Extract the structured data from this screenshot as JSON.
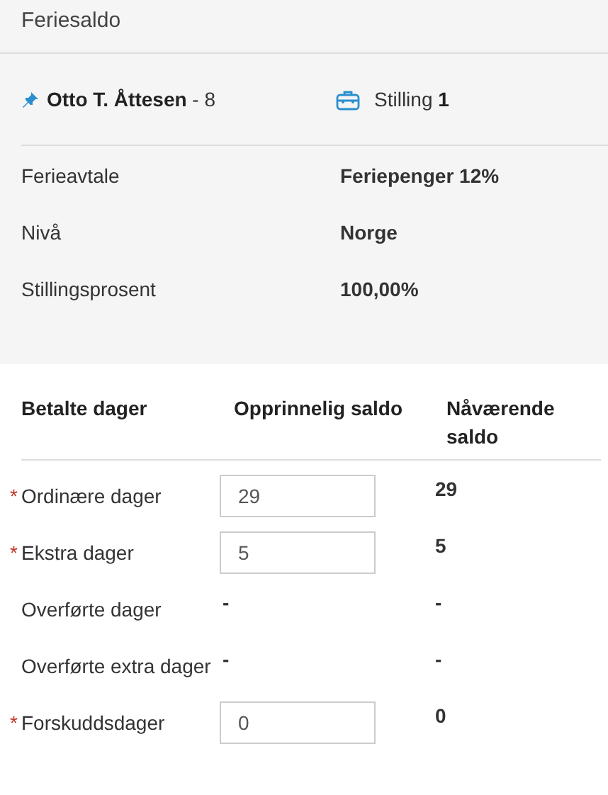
{
  "title": "Feriesaldo",
  "employee": {
    "name": "Otto T. Åttesen",
    "suffix": "- 8",
    "position_label": "Stilling",
    "position_number": "1"
  },
  "details": [
    {
      "label": "Ferieavtale",
      "value": "Feriepenger 12%"
    },
    {
      "label": "Nivå",
      "value": "Norge"
    },
    {
      "label": "Stillingsprosent",
      "value": "100,00%"
    }
  ],
  "table": {
    "columns": [
      "Betalte dager",
      "Opprinnelig saldo",
      "Nåværende saldo"
    ],
    "rows": [
      {
        "marker": "*",
        "label": "Ordinære dager",
        "kind": "input",
        "original": "29",
        "current": "29"
      },
      {
        "marker": "*",
        "label": "Ekstra dager",
        "kind": "input",
        "original": "5",
        "current": "5"
      },
      {
        "label": "Overførte dager",
        "kind": "text",
        "original": "-",
        "current": "-"
      },
      {
        "label": "Overførte extra dager",
        "kind": "text",
        "original": "-",
        "current": "-"
      },
      {
        "marker": "*",
        "label": "Forskuddsdager",
        "kind": "input",
        "original": "0",
        "current": "0"
      }
    ]
  }
}
